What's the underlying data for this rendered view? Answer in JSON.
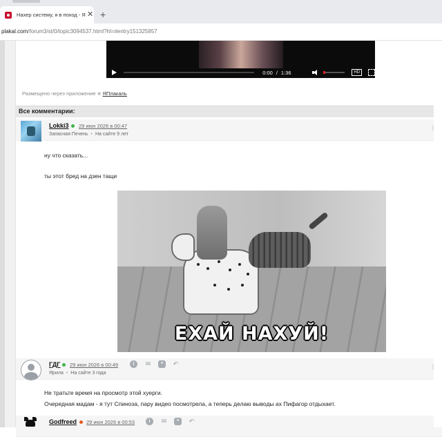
{
  "browser": {
    "tab_title": "Нахер систему, я в поход - ЯП",
    "tab_close": "✕",
    "new_tab": "+",
    "url_host": "plakal.com",
    "url_path": "/forum3/st/0/topic3094537.html?hl=#entry151325857"
  },
  "video": {
    "time_current": "0:00",
    "time_sep": "/",
    "time_total": "1:36",
    "hd_label": "HD"
  },
  "posted_via": {
    "text": "Размещено через приложение",
    "app_link": "ЯПлакаль"
  },
  "section": {
    "all_comments": "Все комментарии:"
  },
  "comments": [
    {
      "author": "Lokki3",
      "online_color": "#3bb54a",
      "date": "29 июн 2026 в 00:47",
      "rank": "Запасная Печень",
      "tenure": "На сайте 9 лет",
      "lines": [
        "ну что сказать...",
        "ты этот бред на дзен тащи"
      ],
      "gif_caption": "ЕХАЙ НАХУЙ!"
    },
    {
      "author": "ГДГ",
      "online_color": "#3bb54a",
      "date": "29 июн 2026 в 00:49",
      "rank": "Ярила",
      "tenure": "На сайте 3 года",
      "lines": [
        "Не тратьте время на просмотр этой хуерги.",
        "Очередная мадам - я тут Спиноза, пару видео посмотрела, а теперь делаю выводы ах Пифагор отдыхает."
      ]
    },
    {
      "author": "Godfreed",
      "online_color": "#e85a1e",
      "date": "29 июн 2026 в 00:53"
    }
  ],
  "icons": {
    "info": "i",
    "mail": "✉",
    "quote": "❝",
    "reply": "↶"
  }
}
